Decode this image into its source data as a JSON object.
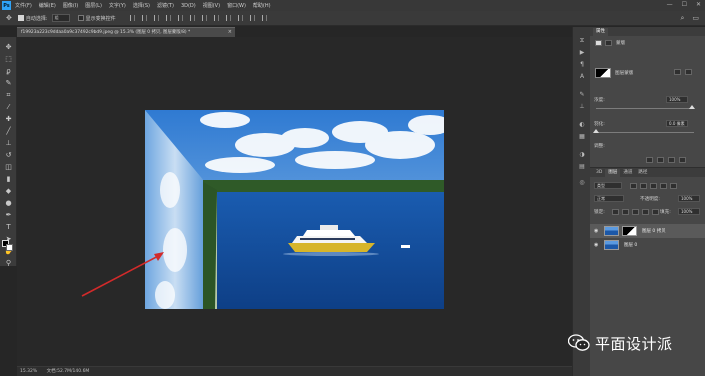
{
  "app": {
    "logo": "Ps"
  },
  "menubar": {
    "items": [
      "文件(F)",
      "编辑(E)",
      "图像(I)",
      "图层(L)",
      "文字(Y)",
      "选择(S)",
      "滤镜(T)",
      "3D(D)",
      "视图(V)",
      "窗口(W)",
      "帮助(H)"
    ],
    "window_controls": [
      "—",
      "☐",
      "✕"
    ]
  },
  "options": {
    "auto_select_label": "自动选择:",
    "auto_select_value": "组",
    "transform_controls_label": "显示变换控件"
  },
  "document": {
    "tab_title": "f19923a223c9ddaa0a9c37492c9bd9.jpeg @ 15.3% (图层 0 拷贝, 图层蒙版/8) *",
    "close_glyph": "×"
  },
  "statusbar": {
    "zoom": "15.32%",
    "doc_info": "文档:52.7M/140.6M"
  },
  "properties": {
    "tab": "属性",
    "mask_label": "蒙版",
    "layer_mask_label": "图层蒙版",
    "density_label": "浓度:",
    "density_value": "100%",
    "feather_label": "羽化:",
    "feather_value": "0.0 像素",
    "adjust_label": "调整:"
  },
  "layers": {
    "tabs": [
      "3D",
      "图层",
      "通道",
      "路径"
    ],
    "kind_label": "类型",
    "blend_mode": "正常",
    "opacity_label": "不透明度:",
    "opacity_value": "100%",
    "lock_label": "锁定:",
    "fill_label": "填充:",
    "fill_value": "100%",
    "rows": [
      {
        "name": "图层 0 拷贝",
        "selected": true
      },
      {
        "name": "图层 0",
        "selected": false
      }
    ]
  },
  "watermark": {
    "text": "平面设计派"
  },
  "colors": {
    "sky": "#4d8fd6",
    "sea": "#1c58a8",
    "tree": "#2f5a28",
    "arrow": "#d22a2a",
    "yacht_hull": "#d7b52a"
  }
}
